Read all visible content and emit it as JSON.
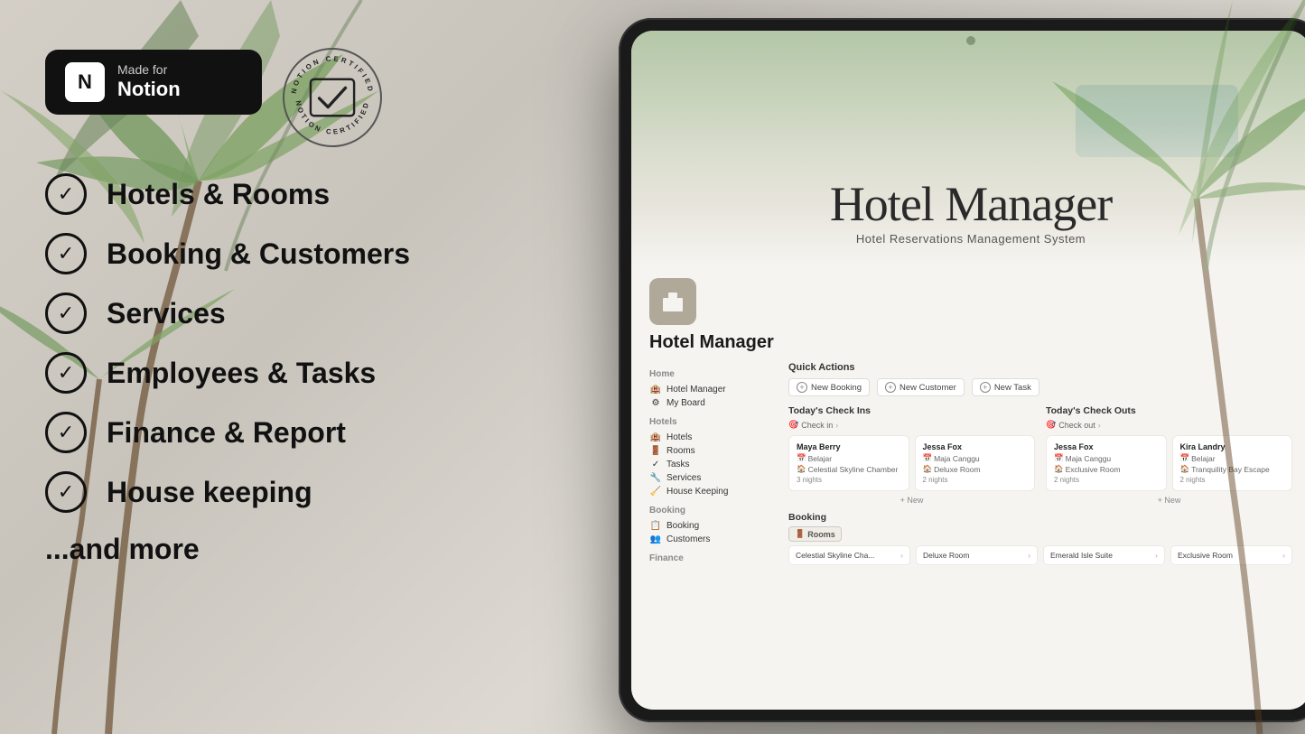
{
  "background": {
    "color": "#d6d1c8"
  },
  "notion_badge": {
    "made_for": "Made for",
    "brand": "Notion"
  },
  "certified_badge": {
    "top_text": "NOTION CERTIFIED",
    "bottom_text": "NOTION CERTIFIED",
    "check": "✓"
  },
  "features": [
    {
      "id": "hotels-rooms",
      "label": "Hotels & Rooms"
    },
    {
      "id": "booking-customers",
      "label": "Booking & Customers"
    },
    {
      "id": "services",
      "label": "Services"
    },
    {
      "id": "employees-tasks",
      "label": "Employees & Tasks"
    },
    {
      "id": "finance-report",
      "label": "Finance & Report"
    },
    {
      "id": "housekeeping",
      "label": "House keeping"
    }
  ],
  "more_label": "...and more",
  "tablet": {
    "header": {
      "title": "Hotel Manager",
      "subtitle": "Hotel Reservations Management System"
    },
    "workspace_title": "Hotel Manager",
    "sidebar": {
      "home_section": "Home",
      "home_items": [
        {
          "icon": "🏨",
          "label": "Hotel Manager"
        },
        {
          "icon": "⚙",
          "label": "My Board"
        }
      ],
      "hotels_section": "Hotels",
      "hotels_items": [
        {
          "icon": "🏨",
          "label": "Hotels"
        },
        {
          "icon": "🚪",
          "label": "Rooms"
        },
        {
          "icon": "✓",
          "label": "Tasks"
        },
        {
          "icon": "🔧",
          "label": "Services"
        },
        {
          "icon": "🧹",
          "label": "House Keeping"
        }
      ],
      "booking_section": "Booking",
      "booking_items": [
        {
          "icon": "📋",
          "label": "Booking"
        },
        {
          "icon": "👥",
          "label": "Customers"
        }
      ],
      "finance_section": "Finance"
    },
    "quick_actions": {
      "title": "Quick Actions",
      "buttons": [
        {
          "label": "New Booking"
        },
        {
          "label": "New Customer"
        },
        {
          "label": "New Task"
        }
      ]
    },
    "checkins": {
      "title": "Today's Check Ins",
      "action": "Check in",
      "cards": [
        {
          "guest": "Maya Berry",
          "location": "Belajar",
          "room": "Celestial Skyline Chamber",
          "nights": "3 nights"
        },
        {
          "guest": "Jessa Fox",
          "location": "Maja Canggu",
          "room": "Deluxe Room",
          "nights": "2 nights"
        }
      ],
      "new_button": "+ New"
    },
    "checkouts": {
      "title": "Today's Check Outs",
      "action": "Check out",
      "cards": [
        {
          "guest": "Jessa Fox",
          "location": "Maja Canggu",
          "room": "Exclusive Room",
          "nights": "2 nights"
        },
        {
          "guest": "Kira Landry",
          "location": "Belajar",
          "room": "Tranquility Bay Escape",
          "nights": "2 nights"
        }
      ],
      "new_button": "+ New"
    },
    "booking_section": {
      "title": "Booking",
      "tabs": [
        "Rooms",
        "..."
      ],
      "active_tab": "Rooms",
      "room_cards": [
        {
          "label": "Celestial Skyline Cha..."
        },
        {
          "label": "Deluxe Room"
        },
        {
          "label": "Emerald Isle Suite"
        },
        {
          "label": "Exclusive Room"
        }
      ]
    }
  }
}
